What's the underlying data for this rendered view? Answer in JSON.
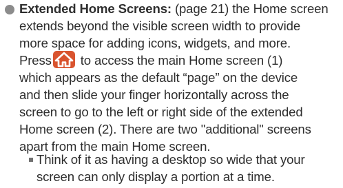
{
  "item": {
    "title": "Extended Home Screens:",
    "lines": [
      " (page 21) the Home screen",
      "extends beyond the visible screen width to provide",
      "more space for adding icons, widgets, and more.",
      "Press",
      "to access the main Home screen (1)",
      "which appears as the default “page” on the device",
      "and then slide your finger horizontally across the",
      "screen to go to the left or right side of the extended",
      "Home screen (2). There are two \"additional\" screens",
      "apart from the main Home screen."
    ],
    "icon": "home-key-icon",
    "icon_color": "#d9542f"
  },
  "sub_item": {
    "lines": [
      "Think of it as having a desktop so wide that your",
      "screen can only display a portion at a time."
    ]
  }
}
